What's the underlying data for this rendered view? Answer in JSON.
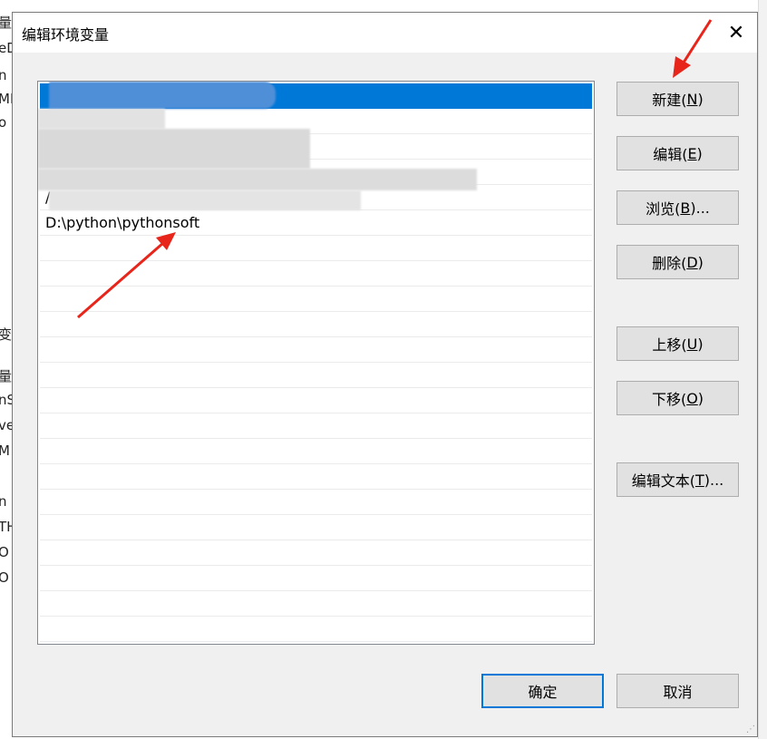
{
  "dialog": {
    "title": "编辑环境变量",
    "close_glyph": "✕"
  },
  "paths": [
    {
      "text": "",
      "selected": true
    },
    {
      "text": ""
    },
    {
      "text": ""
    },
    {
      "text": ""
    },
    {
      "text": "/"
    },
    {
      "text": "D:\\python\\pythonsoft"
    }
  ],
  "buttons": {
    "new": {
      "label": "新建(",
      "key": "N",
      "tail": ")"
    },
    "edit": {
      "label": "编辑(",
      "key": "E",
      "tail": ")"
    },
    "browse": {
      "label": "浏览(",
      "key": "B",
      "tail": ")..."
    },
    "delete": {
      "label": "删除(",
      "key": "D",
      "tail": ")"
    },
    "move_up": {
      "label": "上移(",
      "key": "U",
      "tail": ")"
    },
    "move_down": {
      "label": "下移(",
      "key": "O",
      "tail": ")"
    },
    "edit_text": {
      "label": "编辑文本(",
      "key": "T",
      "tail": ")..."
    },
    "ok": "确定",
    "cancel": "取消"
  },
  "background_fragments": [
    "量",
    "eD",
    "n",
    "MF",
    "o",
    "变量",
    "量",
    "nS",
    "ve",
    "M",
    "n",
    "TH",
    "O",
    "O"
  ],
  "colors": {
    "selection": "#0078d7",
    "annotation_arrow": "#e8251b"
  }
}
